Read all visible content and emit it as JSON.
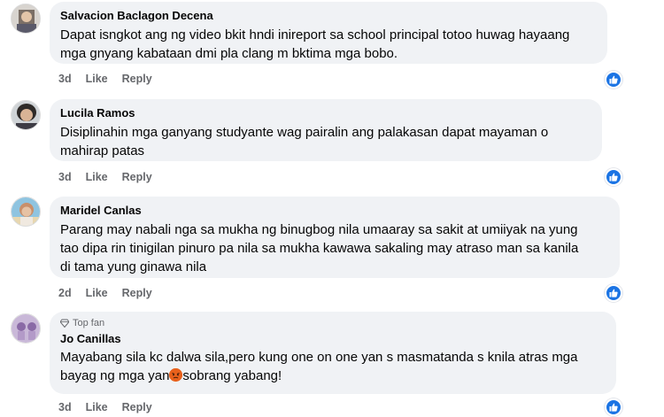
{
  "comments": [
    {
      "author": "Salvacion Baclagon Decena",
      "lines": [
        "Dapat isngkot ang ng video bkit hndi inireport sa school principal totoo huwag hayaang",
        "mga gnyang kabataan dmi pla clang m bktima mga bobo."
      ],
      "time": "3d",
      "like_label": "Like",
      "reply_label": "Reply",
      "reaction_icon": "like-reaction-icon"
    },
    {
      "author": "Lucila Ramos",
      "lines": [
        "Disiplinahin mga ganyang studyante wag pairalin ang palakasan dapat mayaman o",
        "mahirap patas"
      ],
      "time": "3d",
      "like_label": "Like",
      "reply_label": "Reply",
      "reaction_icon": "like-reaction-icon"
    },
    {
      "author": "Maridel Canlas",
      "lines": [
        "Parang may nabali nga sa mukha ng binugbog nila umaaray sa sakit at umiiyak na yung",
        "tao dipa rin tinigilan pinuro pa nila sa mukha kawawa sakaling may atraso man sa kanila",
        "di tama yung ginawa nila"
      ],
      "time": "2d",
      "like_label": "Like",
      "reply_label": "Reply",
      "reaction_icon": "like-reaction-icon"
    },
    {
      "badge": "Top fan",
      "author": "Jo Canillas",
      "lines": [
        "Mayabang sila kc dalwa sila,pero kung one on one yan s masmatanda s knila atras mga",
        "bayag ng mga yan",
        "sobrang yabang!"
      ],
      "time": "3d",
      "like_label": "Like",
      "reply_label": "Reply",
      "reaction_icon": "like-reaction-icon"
    }
  ],
  "colors": {
    "bubble": "#f0f2f5",
    "meta_text": "#65676b",
    "like_blue": "#1b74e4",
    "angry_emoji": "#e8611c"
  }
}
